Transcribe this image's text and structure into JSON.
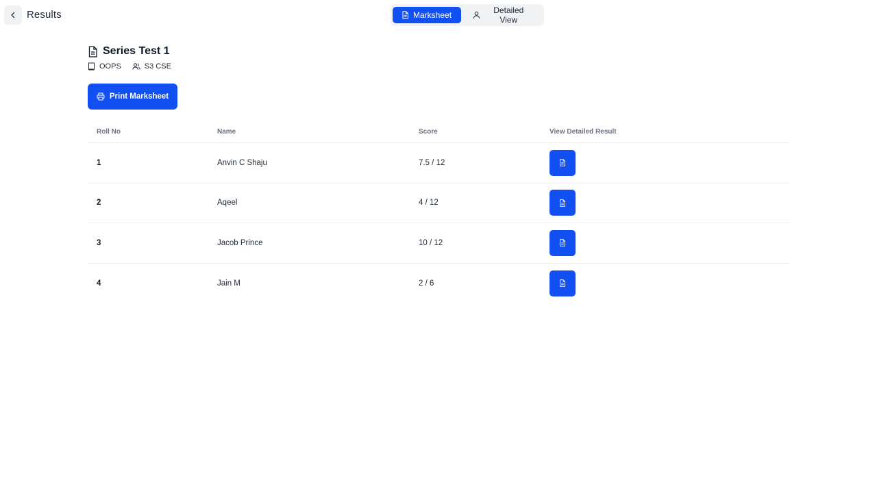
{
  "header": {
    "title": "Results",
    "tabs": [
      {
        "label": "Marksheet",
        "icon": "document-icon",
        "active": true
      },
      {
        "label": "Detailed View",
        "icon": "user-icon",
        "active": false
      }
    ]
  },
  "test": {
    "title": "Series Test 1",
    "subject": "OOPS",
    "class": "S3 CSE",
    "print_label": "Print Marksheet"
  },
  "table": {
    "columns": [
      "Roll No",
      "Name",
      "Score",
      "View Detailed Result"
    ],
    "rows": [
      {
        "roll": "1",
        "name": "Anvin C Shaju",
        "score": "7.5 / 12"
      },
      {
        "roll": "2",
        "name": "Aqeel",
        "score": "4 / 12"
      },
      {
        "roll": "3",
        "name": "Jacob Prince",
        "score": "10 / 12"
      },
      {
        "roll": "4",
        "name": "Jain M",
        "score": "2 / 6"
      }
    ]
  },
  "colors": {
    "accent": "#1250f2",
    "toggle_bg": "#f1f2f4",
    "divider": "#ececef"
  }
}
